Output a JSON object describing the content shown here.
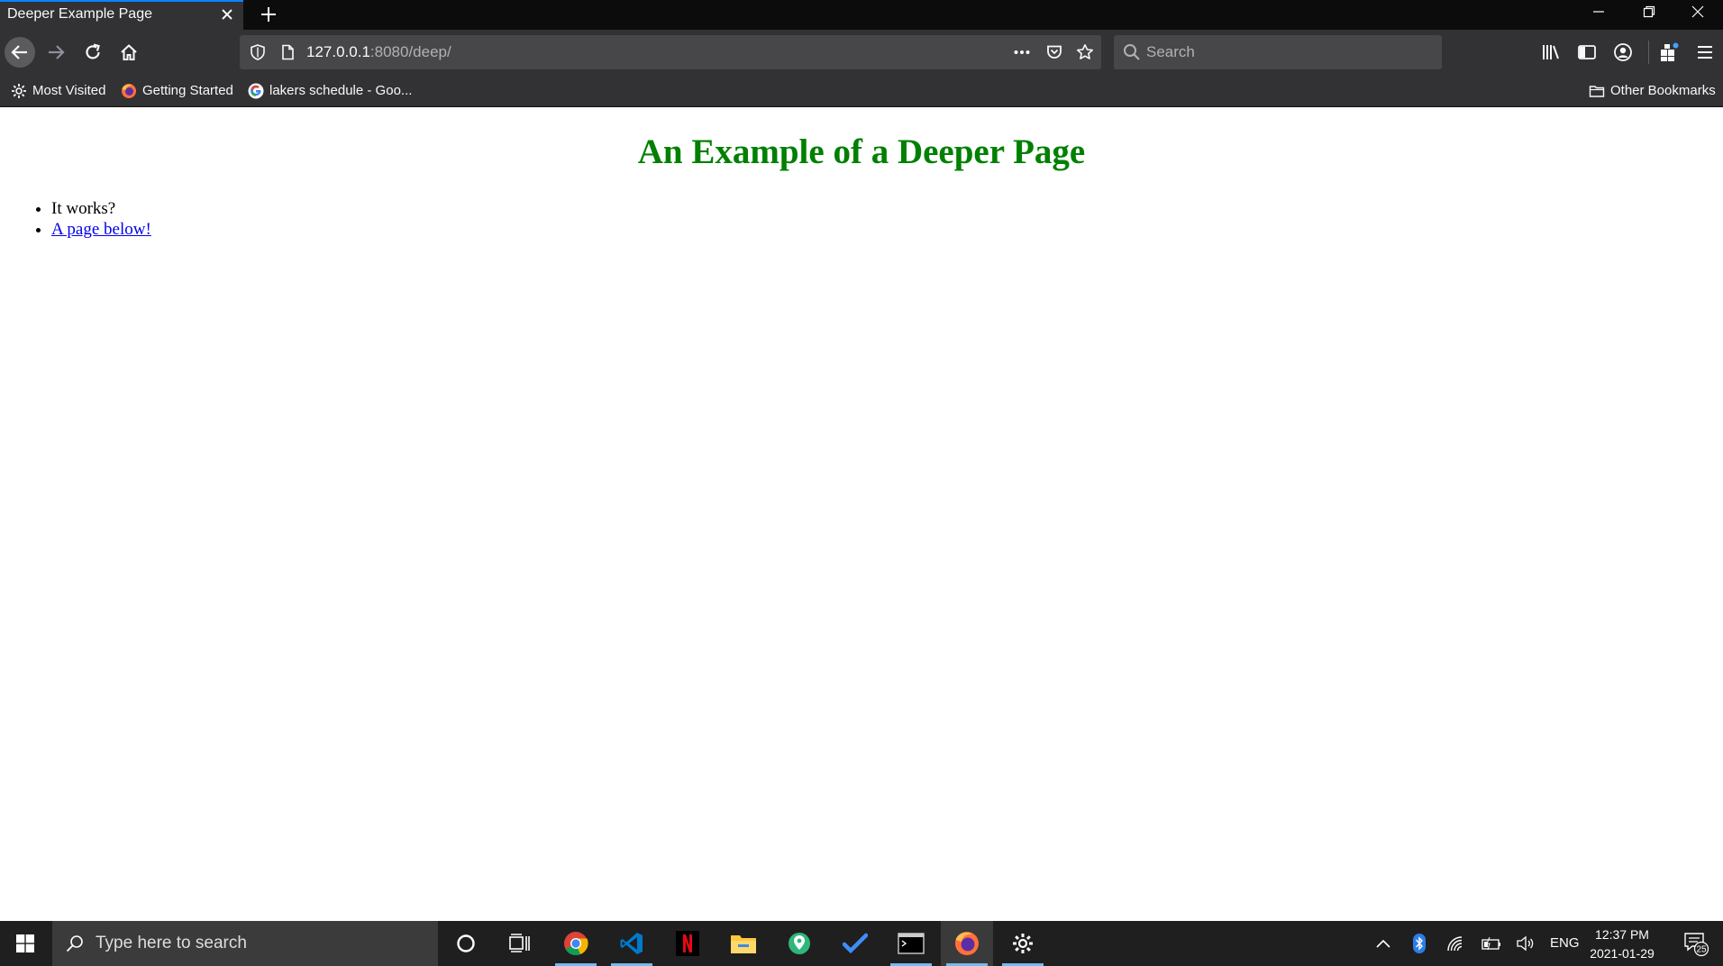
{
  "browser": {
    "tab_title": "Deeper Example Page",
    "url_host": "127.0.0.1",
    "url_rest": ":8080/deep/",
    "search_placeholder": "Search",
    "bookmarks": [
      {
        "label": "Most Visited",
        "icon": "gear-icon"
      },
      {
        "label": "Getting Started",
        "icon": "firefox-icon"
      },
      {
        "label": "lakers schedule - Goo...",
        "icon": "google-icon"
      }
    ],
    "other_bookmarks": "Other Bookmarks"
  },
  "page": {
    "heading": "An Example of a Deeper Page",
    "items": [
      "It works?"
    ],
    "link_text": "A page below!",
    "heading_color": "#008000",
    "link_color": "#0000ee"
  },
  "taskbar": {
    "search_placeholder": "Type here to search",
    "apps": [
      "cortana-icon",
      "task-view-icon",
      "chrome-icon",
      "vscode-icon",
      "netflix-icon",
      "file-explorer-icon",
      "maps-icon",
      "todo-icon",
      "terminal-icon",
      "firefox-icon",
      "settings-icon"
    ],
    "language": "ENG",
    "time": "12:37 PM",
    "date": "2021-01-29",
    "notification_count": "25"
  }
}
